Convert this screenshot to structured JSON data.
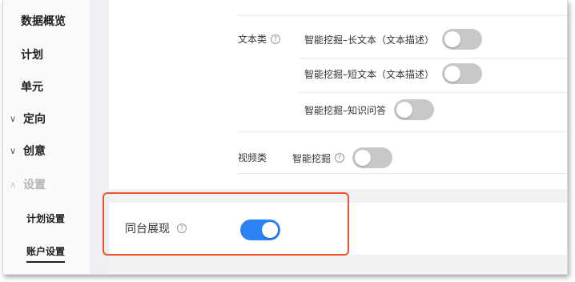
{
  "sidebar": {
    "items": [
      {
        "label": "数据概览",
        "chevron": ""
      },
      {
        "label": "计划",
        "chevron": ""
      },
      {
        "label": "单元",
        "chevron": ""
      },
      {
        "label": "定向",
        "chevron": "∨"
      },
      {
        "label": "创意",
        "chevron": "∨"
      },
      {
        "label": "设置",
        "chevron": "∧"
      }
    ],
    "subitems": [
      {
        "label": "计划设置"
      },
      {
        "label": "账户设置"
      }
    ]
  },
  "settings": {
    "text_group": {
      "label": "文本类",
      "help_icon": "question-circle-icon",
      "options": [
        {
          "label": "智能挖掘–长文本（文本描述）",
          "enabled": false
        },
        {
          "label": "智能挖掘–短文本（文本描述）",
          "enabled": false
        },
        {
          "label": "智能挖掘–知识问答",
          "enabled": false
        }
      ]
    },
    "video_group": {
      "label": "视频类",
      "options": [
        {
          "label": "智能挖掘",
          "help_icon": "question-circle-icon",
          "enabled": false
        }
      ]
    },
    "same_stage": {
      "label": "同台展现",
      "help_icon": "question-circle-icon",
      "enabled": true
    }
  },
  "colors": {
    "toggle_on": "#2b83f6",
    "toggle_off": "#c8c8c8",
    "highlight_border": "#f2532c"
  }
}
